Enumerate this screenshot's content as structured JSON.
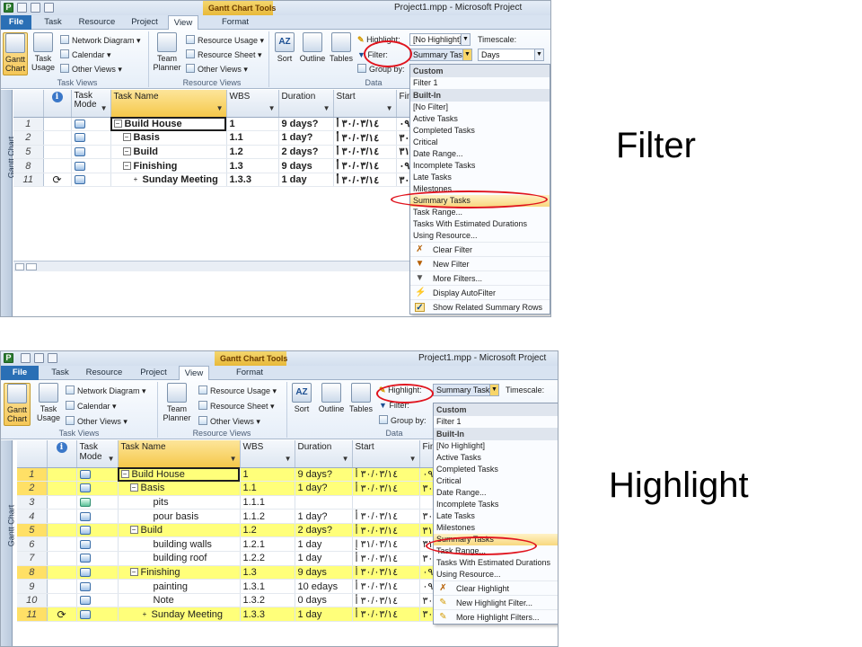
{
  "callouts": {
    "top": "Filter",
    "bottom": "Highlight"
  },
  "shot1": {
    "window_title": "Project1.mpp - Microsoft Project",
    "tools_tab": "Gantt Chart Tools",
    "tabs": [
      "File",
      "Task",
      "Resource",
      "Project",
      "View",
      "Format"
    ],
    "ribbon": {
      "gantt_chart": "Gantt Chart",
      "task_usage": "Task Usage",
      "network_diagram": "Network Diagram",
      "calendar": "Calendar",
      "other_views_1": "Other Views",
      "team_planner": "Team Planner",
      "resource_usage": "Resource Usage",
      "resource_sheet": "Resource Sheet",
      "other_views_2": "Other Views",
      "sort": "Sort",
      "outline": "Outline",
      "tables": "Tables",
      "highlight_label": "Highlight:",
      "highlight_value": "[No Highlight]",
      "filter_label": "Filter:",
      "filter_value": "Summary Tasks",
      "group_label": "Group by:",
      "timescale_label": "Timescale:",
      "timescale_value": "Days",
      "group_task_views": "Task Views",
      "group_resource_views": "Resource Views",
      "group_data": "Data"
    },
    "side_label": "Gantt Chart",
    "columns": [
      "",
      "Task Mode",
      "Task Name",
      "WBS",
      "Duration",
      "Start",
      "Fin"
    ],
    "rows": [
      {
        "id": "1",
        "name": "Build House",
        "wbs": "1",
        "duration": "9 days?",
        "start": "٣٠/٠٣/١٤ أ",
        "finish": "٠٩"
      },
      {
        "id": "2",
        "name": "Basis",
        "wbs": "1.1",
        "duration": "1 day?",
        "start": "٣٠/٠٣/١٤ أ",
        "finish": "٣٠"
      },
      {
        "id": "5",
        "name": "Build",
        "wbs": "1.2",
        "duration": "2 days?",
        "start": "٣٠/٠٣/١٤ أ",
        "finish": "٣١"
      },
      {
        "id": "8",
        "name": "Finishing",
        "wbs": "1.3",
        "duration": "9 days",
        "start": "٣٠/٠٣/١٤ أ",
        "finish": "٠٩"
      },
      {
        "id": "11",
        "name": "Sunday Meeting",
        "wbs": "1.3.3",
        "duration": "1 day",
        "start": "٣٠/٠٣/١٤ أ",
        "finish": "٣٠"
      }
    ],
    "menu": {
      "custom_header": "Custom",
      "custom_items": [
        "Filter 1"
      ],
      "builtin_header": "Built-In",
      "builtin_items": [
        "[No Filter]",
        "Active Tasks",
        "Completed Tasks",
        "Critical",
        "Date Range...",
        "Incomplete Tasks",
        "Late Tasks",
        "Milestones",
        "Summary Tasks",
        "Task Range...",
        "Tasks With Estimated Durations",
        "Using Resource..."
      ],
      "commands": [
        "Clear Filter",
        "New Filter",
        "More Filters...",
        "Display AutoFilter",
        "Show Related Summary Rows"
      ]
    }
  },
  "shot2": {
    "window_title": "Project1.mpp - Microsoft Project",
    "tools_tab": "Gantt Chart Tools",
    "tabs": [
      "File",
      "Task",
      "Resource",
      "Project",
      "View",
      "Format"
    ],
    "ribbon": {
      "gantt_chart": "Gantt Chart",
      "task_usage": "Task Usage",
      "network_diagram": "Network Diagram",
      "calendar": "Calendar",
      "other_views_1": "Other Views",
      "team_planner": "Team Planner",
      "resource_usage": "Resource Usage",
      "resource_sheet": "Resource Sheet",
      "other_views_2": "Other Views",
      "sort": "Sort",
      "outline": "Outline",
      "tables": "Tables",
      "highlight_label": "Highlight:",
      "highlight_value": "Summary Tasks",
      "filter_label": "Filter:",
      "group_label": "Group by:",
      "timescale_label": "Timescale:",
      "group_task_views": "Task Views",
      "group_resource_views": "Resource Views",
      "group_data": "Data"
    },
    "side_label": "Gantt Chart",
    "columns": [
      "",
      "Task Mode",
      "Task Name",
      "WBS",
      "Duration",
      "Start",
      "Fin"
    ],
    "rows": [
      {
        "id": "1",
        "name": "Build House",
        "wbs": "1",
        "duration": "9 days?",
        "start": "٣٠/٠٣/١٤ أ",
        "finish": "٠٩"
      },
      {
        "id": "2",
        "name": "Basis",
        "wbs": "1.1",
        "duration": "1 day?",
        "start": "٣٠/٠٣/١٤ أ",
        "finish": "٣٠"
      },
      {
        "id": "3",
        "name": "pits",
        "wbs": "1.1.1",
        "duration": "",
        "start": "",
        "finish": ""
      },
      {
        "id": "4",
        "name": "pour basis",
        "wbs": "1.1.2",
        "duration": "1 day?",
        "start": "٣٠/٠٣/١٤ أ",
        "finish": "٣٠"
      },
      {
        "id": "5",
        "name": "Build",
        "wbs": "1.2",
        "duration": "2 days?",
        "start": "٣٠/٠٣/١٤ أ",
        "finish": "٣١"
      },
      {
        "id": "6",
        "name": "building walls",
        "wbs": "1.2.1",
        "duration": "1 day",
        "start": "٣١/٠٣/١٤ إ",
        "finish": "٣١"
      },
      {
        "id": "7",
        "name": "building roof",
        "wbs": "1.2.2",
        "duration": "1 day",
        "start": "٣٠/٠٣/١٤ أ",
        "finish": "٣٠"
      },
      {
        "id": "8",
        "name": "Finishing",
        "wbs": "1.3",
        "duration": "9 days",
        "start": "٣٠/٠٣/١٤ أ",
        "finish": "٠٩"
      },
      {
        "id": "9",
        "name": "painting",
        "wbs": "1.3.1",
        "duration": "10 edays",
        "start": "٣٠/٠٣/١٤ أ",
        "finish": "٠٩"
      },
      {
        "id": "10",
        "name": "Note",
        "wbs": "1.3.2",
        "duration": "0 days",
        "start": "٣٠/٠٣/١٤ أ",
        "finish": "٣٠"
      },
      {
        "id": "11",
        "name": "Sunday Meeting",
        "wbs": "1.3.3",
        "duration": "1 day",
        "start": "٣٠/٠٣/١٤ أ",
        "finish": "٣٠"
      }
    ],
    "menu": {
      "custom_header": "Custom",
      "custom_items": [
        "Filter 1"
      ],
      "builtin_header": "Built-In",
      "builtin_items": [
        "[No Highlight]",
        "Active Tasks",
        "Completed Tasks",
        "Critical",
        "Date Range...",
        "Incomplete Tasks",
        "Late Tasks",
        "Milestones",
        "Summary Tasks",
        "Task Range...",
        "Tasks With Estimated Durations",
        "Using Resource..."
      ],
      "commands": [
        "Clear Highlight",
        "New Highlight Filter...",
        "More Highlight Filters..."
      ]
    }
  }
}
